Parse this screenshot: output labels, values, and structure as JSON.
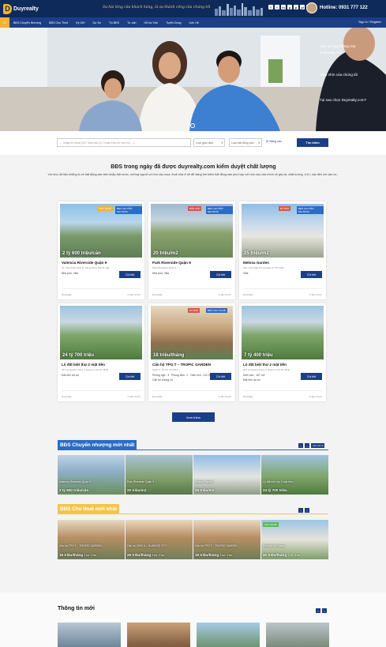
{
  "header": {
    "logo_text": "Duyrealty",
    "logo_letter": "D",
    "slogan": "Sự hài lòng của khách hàng, là sự thành công của chúng tôi",
    "socials": [
      "f",
      "t",
      "in",
      "g",
      "p",
      "yt",
      "ig"
    ],
    "hotline_label": "Hotline: 0931 777 122"
  },
  "nav": {
    "items": [
      "BĐS Chuyển Nhượng",
      "BĐS Cho Thuê",
      "Ký Gửi",
      "Dự Án",
      "Tin BĐS",
      "Tư vấn",
      "Hỗ trợ Vốn",
      "Tuyển Dụng",
      "Liên Hệ"
    ],
    "auth": "Sign in / Register"
  },
  "hero": {
    "texts": [
      "Lịch sử hoạt động của",
      "Duyrealty.com",
      "Tầm nhìn của chúng tôi",
      "Tại sao chọn Duyrealty.com?"
    ]
  },
  "search": {
    "placeholder": "Nhập từ khóa (VD: Nhà bán Q.7 hoặc Địa chỉ cần tìm ...)",
    "type_label": "Loại giao dịch",
    "property_label": "Loại bất động sản",
    "advanced": "Nâng cao",
    "button": "Tìm kiếm"
  },
  "verified": {
    "title": "BĐS trong ngày đã được duyrealty.com kiểm duyệt chất lượng",
    "desc": "Với kho dữ liệu khổng lồ về bất động sản trên khắp đất nước, những người có nhu cầu mua, thuê nhà ở sẽ dễ dàng tìm kiếm bất động sản phù hợp với nhu cầu của mình về giá cả, chất lượng, vị trí, các tiện ích cần có..."
  },
  "listings": [
    {
      "price": "2 tỷ 600 triệu/căn",
      "title": "Valencia Riverside Quận 9",
      "addr": "61, Cầu Xanh Chữ G, Tăng Nhơn Phú B, HĐ...",
      "type": "Nhà phố, Villa",
      "tag": "CHO THUÊ",
      "tag2": "BĐS CHUYỂN NHƯỢNG",
      "agent": "Duyrealty",
      "date": "4 năm trước",
      "btn": "Chi tiết"
    },
    {
      "price": "20 triệu/m2",
      "title": "Park Riverside Quận 9",
      "addr": "Park Riverside Quận 9",
      "type": "Nhà phố, Villa",
      "tag": "BÁN GẤP",
      "tag2": "BĐS CHUYỂN NHƯỢNG",
      "agent": "Duyrealty",
      "date": "4 năm trước",
      "btn": "Chi tiết"
    },
    {
      "price": "25 triệu/m2",
      "title": "Melosa Garden",
      "addr": "220, Vành Đai Trong Quận 9, TP HCM",
      "type": "Villa",
      "tag": "ĐÃ BÁN",
      "tag2": "BĐS CHUYỂN NHƯỢNG",
      "agent": "Duyrealty",
      "date": "4 năm trước",
      "btn": "Chi tiết"
    },
    {
      "price": "24 tỷ 700 triệu",
      "title": "Lô đất biệt thự 2 mặt tiền",
      "addr": "207 Lê Quang Sung, 6 Quận 6, Hồ Chí Minh",
      "type": "Đất nền dự án",
      "tag": "",
      "tag2": "",
      "agent": "Duyrealty",
      "date": "4 năm trước",
      "btn": "Chi tiết"
    },
    {
      "price": "18 triệu/tháng",
      "title": "Căn hộ TPO.T – TROPIC GARDEN",
      "addr": "Quận 2, TP Hồ Chí Minh",
      "type": "Phòng ngủ : 3 · Phòng tắm : 2 · Diện tích : 112 m²",
      "type2": "Căn hộ chung cư",
      "tag": "ĐÃ BÁN",
      "tag2": "BĐS CHO THUÊ",
      "agent": "Duyrealty",
      "date": "4 năm trước",
      "btn": "Chi tiết"
    },
    {
      "price": "7 tỷ 400 triệu",
      "title": "Lô đất biệt thự 2 mặt tiền",
      "addr": "207 Lê Quang Sung, 6 Quận 6, Hồ Chí Minh",
      "type": "Diện tích : 157 m2",
      "type2": "Đất nền dự án",
      "tag": "",
      "tag2": "",
      "agent": "Duyrealty",
      "date": "4 năm trước",
      "btn": "Chi tiết"
    }
  ],
  "more_button": "Xem thêm",
  "transfer_section": {
    "title": "BĐS Chuyển nhượng mới nhất",
    "viewall": "Xem tất cả",
    "items": [
      {
        "caption": "Valencia Riverside Quận 9",
        "price": "2 tỷ 600 triệu/căn"
      },
      {
        "caption": "Park Riverside Quận 9",
        "price": "20 triệu/m2"
      },
      {
        "caption": "Melosa Garden",
        "price": "25 triệu/m2"
      },
      {
        "caption": "Lô đất biệt thự 2 mặt tiền",
        "price": "24 tỷ 700 triệu"
      }
    ]
  },
  "rent_section": {
    "title": "BĐS Cho thuê mới nhất",
    "items": [
      {
        "caption": "Căn hộ TPO.T – TROPIC GARDEN",
        "price": "18 triệu/tháng",
        "meta": "3 bd · 2 ba"
      },
      {
        "caption": "Căn hộ GRIC 5 – SUNRISE CITY",
        "price": "26 triệu/tháng",
        "meta": "3 bd · 2 ba"
      },
      {
        "caption": "Căn hộ TPO.T – TROPIC GARDEN",
        "price": "18 triệu/tháng",
        "meta": "3 bd · 2 ba"
      },
      {
        "caption": "Biệt thự Mỹ Giang",
        "price": "40 triệu/tháng",
        "meta": "4 bd · 4 ba",
        "tag": "CHO THUÊ"
      }
    ]
  },
  "news": {
    "title": "Thông tin mới"
  },
  "colors": {
    "navy": "#0e2a5a",
    "blue": "#1b3f86",
    "gold": "#f2b233",
    "section_blue": "#2b6cc4",
    "section_yellow": "#f5c548"
  }
}
